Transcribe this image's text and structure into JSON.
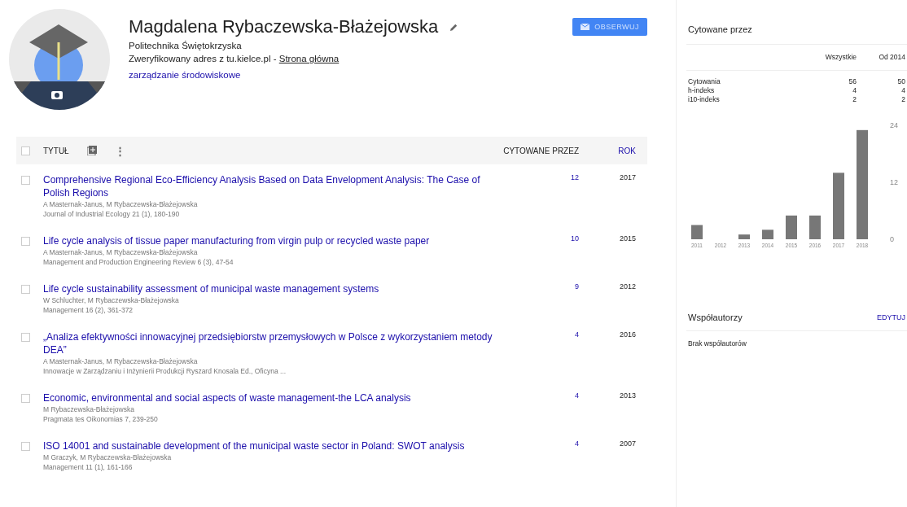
{
  "profile": {
    "name": "Magdalena Rybaczewska-Błażejowska",
    "affiliation": "Politechnika Świętokrzyska",
    "verified": "Zweryfikowany adres z tu.kielce.pl -",
    "homepage": "Strona główna",
    "interest": "zarządzanie środowiskowe",
    "follow": "OBSERWUJ"
  },
  "table": {
    "columns": {
      "title": "TYTUŁ",
      "more": "⋮",
      "cited": "CYTOWANE PRZEZ",
      "year": "ROK"
    },
    "select_all": false,
    "rows": [
      {
        "title": "Comprehensive Regional Eco-Efficiency Analysis Based on Data Envelopment Analysis: The Case of Polish Regions",
        "authors": "A Masternak-Janus, M Rybaczewska-Błażejowska",
        "source": "Journal of Industrial Ecology 21 (1), 180-190",
        "cited": "12",
        "year": "2017",
        "checked": false
      },
      {
        "title": "Life cycle analysis of tissue paper manufacturing from virgin pulp or recycled waste paper",
        "authors": "A Masternak-Janus, M Rybaczewska-Błażejowska",
        "source": "Management and Production Engineering Review 6 (3), 47-54",
        "cited": "10",
        "year": "2015",
        "checked": false
      },
      {
        "title": "Life cycle sustainability assessment of municipal waste management systems",
        "authors": "W Schluchter, M Rybaczewska-Błażejowska",
        "source": "Management 16 (2), 361-372",
        "cited": "9",
        "year": "2012",
        "checked": false
      },
      {
        "title": "„Analiza efektywności innowacyjnej przedsiębiorstw przemysłowych w Polsce z wykorzystaniem metody DEA”",
        "authors": "A Masternak-Janus, M Rybaczewska-Błażejowska",
        "source": "Innowacje w Zarządzaniu i Inżynierii Produkcji Ryszard Knosala Ed., Oficyna ...",
        "cited": "4",
        "year": "2016",
        "checked": false
      },
      {
        "title": "Economic, environmental and social aspects of waste management-the LCA analysis",
        "authors": "M Rybaczewska-Błażejowska",
        "source": "Pragmata tes Oikonomias 7, 239-250",
        "cited": "4",
        "year": "2013",
        "checked": false
      },
      {
        "title": "ISO 14001 and sustainable development of the municipal waste sector in Poland: SWOT analysis",
        "authors": "M Graczyk, M Rybaczewska-Błażejowska",
        "source": "Management 11 (1), 161-166",
        "cited": "4",
        "year": "2007",
        "checked": false
      }
    ]
  },
  "cited_by": {
    "title": "Cytowane przez",
    "headers": [
      "Wszystkie",
      "Od 2014"
    ],
    "rows": [
      {
        "label": "Cytowania",
        "all": "56",
        "since": "50"
      },
      {
        "label": "h-indeks",
        "all": "4",
        "since": "4"
      },
      {
        "label": "i10-indeks",
        "all": "2",
        "since": "2"
      }
    ],
    "chart_data": {
      "type": "bar",
      "categories": [
        "2011",
        "2012",
        "2013",
        "2014",
        "2015",
        "2016",
        "2017",
        "2018"
      ],
      "series": [
        {
          "color": "#777777",
          "values": [
            3,
            0,
            1,
            2,
            5,
            5,
            14,
            23
          ]
        }
      ],
      "ylim": [
        0,
        24
      ],
      "yticks": [
        0,
        12,
        24
      ]
    }
  },
  "coauthors": {
    "title": "Współautorzy",
    "edit": "EDYTUJ",
    "empty": "Brak współautorów"
  }
}
